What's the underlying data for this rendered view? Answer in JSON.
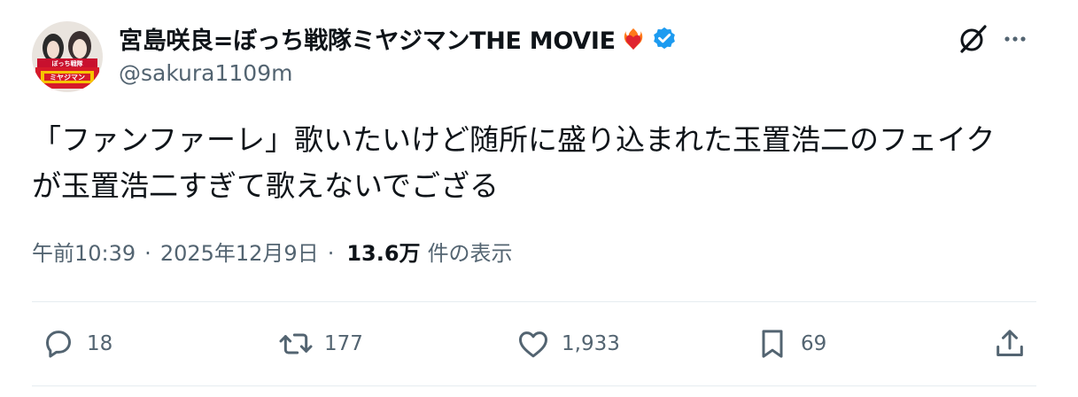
{
  "author": {
    "display_name": "宮島咲良=ぼっち戦隊ミヤジマンTHE MOVIE",
    "handle": "@sakura1109m",
    "emoji": "heart-on-fire",
    "verified": true,
    "avatar_badge_text": "ぼっち戦隊 ミヤジマン",
    "accent_color": "#1d9bf0"
  },
  "tweet": {
    "text": "「ファンファーレ」歌いたいけど随所に盛り込まれた玉置浩二のフェイク\nが玉置浩二すぎて歌えないでござる"
  },
  "meta": {
    "time": "午前10:39",
    "separator": "·",
    "date": "2025年12月9日",
    "views": "13.6万",
    "views_label": "件の表示"
  },
  "actions": {
    "replies": "18",
    "retweets": "177",
    "likes": "1,933",
    "bookmarks": "69"
  },
  "icons": {
    "grok": "grok-icon",
    "more": "more-icon",
    "reply": "reply-icon",
    "retweet": "retweet-icon",
    "like": "heart-icon",
    "bookmark": "bookmark-icon",
    "share": "share-icon"
  }
}
